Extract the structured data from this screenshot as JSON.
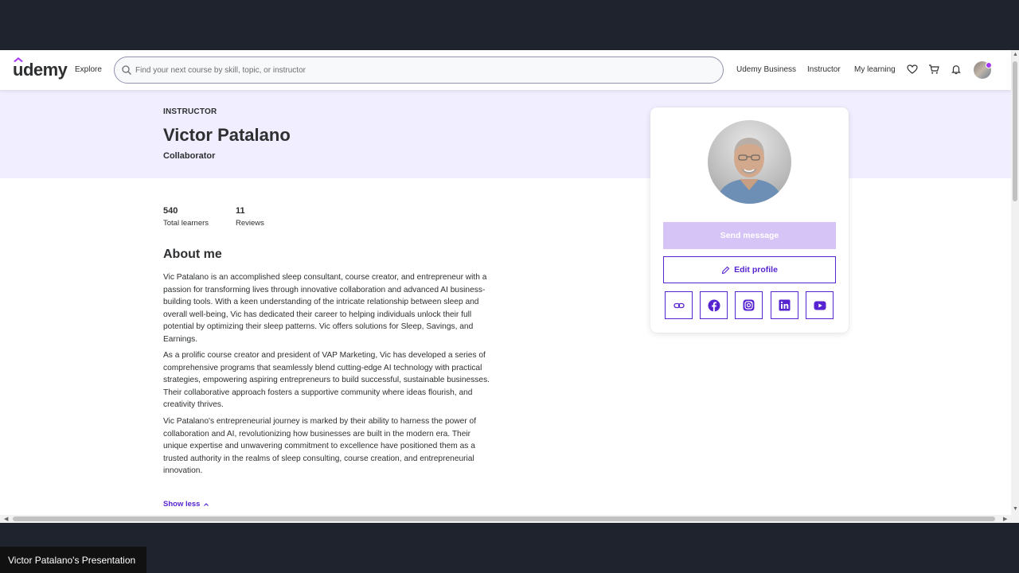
{
  "header": {
    "logo": "udemy",
    "explore": "Explore",
    "search_placeholder": "Find your next course by skill, topic, or instructor",
    "links": [
      "Udemy Business",
      "Instructor",
      "My learning"
    ]
  },
  "profile": {
    "eyebrow": "INSTRUCTOR",
    "name": "Victor Patalano",
    "headline": "Collaborator",
    "stats": [
      {
        "value": "540",
        "label": "Total learners"
      },
      {
        "value": "11",
        "label": "Reviews"
      }
    ],
    "about_heading": "About me",
    "about": [
      "Vic Patalano is an accomplished sleep consultant, course creator, and entrepreneur with a passion for transforming lives through innovative collaboration and advanced AI business-building tools. With a keen understanding of the intricate relationship between sleep and overall well-being, Vic has dedicated their career to helping individuals unlock their full potential by optimizing their sleep patterns.   Vic offers solutions for Sleep, Savings, and Earnings.",
      "As a prolific course creator and president of VAP Marketing, Vic has developed a series of comprehensive programs that seamlessly blend cutting-edge AI technology with practical strategies, empowering aspiring entrepreneurs to build successful, sustainable businesses. Their collaborative approach fosters a supportive community where ideas flourish, and creativity thrives.",
      "Vic Patalano's entrepreneurial journey is marked by their ability to harness the power of collaboration and AI, revolutionizing how businesses are built in the modern era. Their unique expertise and unwavering commitment to excellence have positioned them as a trusted authority in the realms of sleep consulting, course creation, and entrepreneurial innovation."
    ],
    "show_less": "Show less"
  },
  "card": {
    "send_message": "Send message",
    "edit_profile": "Edit profile",
    "socials": [
      "link-icon",
      "facebook-icon",
      "instagram-icon",
      "linkedin-icon",
      "youtube-icon"
    ]
  },
  "colors": {
    "accent": "#5624d0",
    "banner": "#f1efff",
    "send_disabled": "#d7c4f7"
  },
  "caption": "Victor Patalano's Presentation"
}
